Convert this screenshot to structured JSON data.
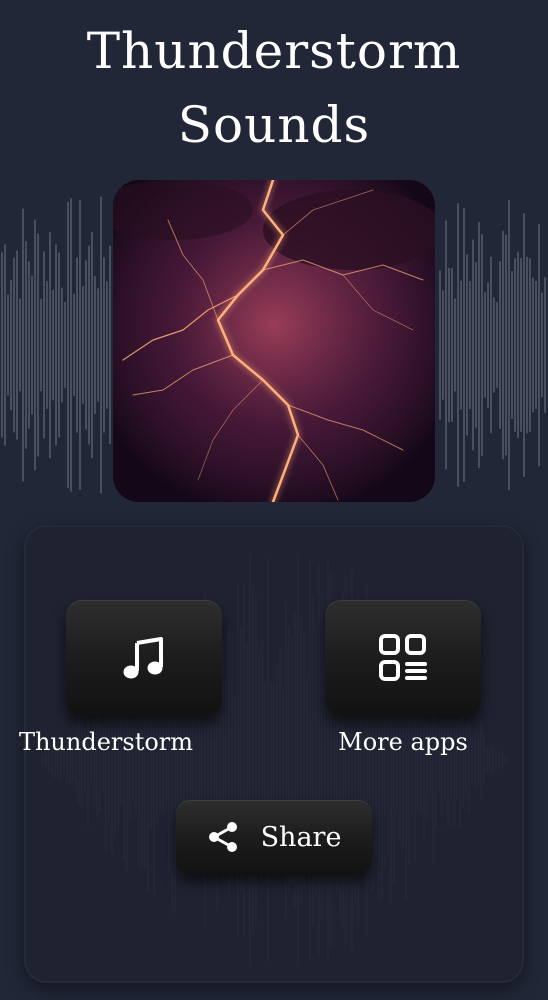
{
  "app": {
    "title": "Thunderstorm Sounds"
  },
  "hero": {
    "image": "lightning-storm",
    "sound_icon": "speaker-volume-icon",
    "sound_button_color": "#d93a3f"
  },
  "menu": {
    "thunderstorm_label": "Thunderstorm",
    "thunderstorm_icon": "music-note-icon",
    "more_apps_label": "More apps",
    "more_apps_icon": "apps-grid-icon",
    "share_label": "Share",
    "share_icon": "share-icon"
  },
  "colors": {
    "background": "#222737",
    "panel": "#1e2230",
    "button": "#1b1b1b",
    "text": "#ffffff"
  }
}
